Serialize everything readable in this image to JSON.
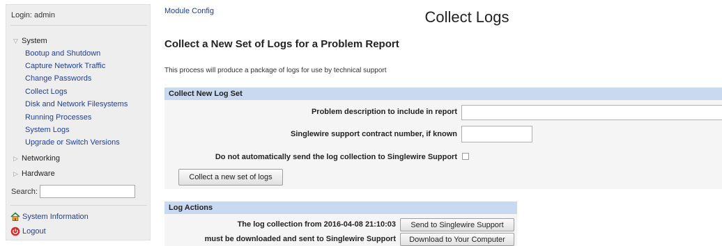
{
  "sidebar": {
    "login": "Login: admin",
    "system": {
      "label": "System",
      "items": [
        "Bootup and Shutdown",
        "Capture Network Traffic",
        "Change Passwords",
        "Collect Logs",
        "Disk and Network Filesystems",
        "Running Processes",
        "System Logs",
        "Upgrade or Switch Versions"
      ]
    },
    "networking": "Networking",
    "hardware": "Hardware",
    "search_label": "Search:",
    "search_value": "",
    "system_information": "System Information",
    "logout": "Logout"
  },
  "main": {
    "module_config": "Module Config",
    "title": "Collect Logs",
    "heading": "Collect a New Set of Logs for a Problem Report",
    "description": "This process will produce a package of logs for use by technical support",
    "collect_section": {
      "header": "Collect New Log Set",
      "problem_label": "Problem description to include in report",
      "problem_value": "",
      "contract_label": "Singlewire support contract number, if known",
      "contract_value": "",
      "nosend_label": "Do not automatically send the log collection to Singlewire Support",
      "nosend_checked": false,
      "collect_button": "Collect a new set of logs"
    },
    "log_actions": {
      "header": "Log Actions",
      "line1": "The log collection from 2016-04-08 21:10:03",
      "line2": "must be downloaded and sent to Singlewire Support",
      "send_button": "Send to Singlewire Support",
      "download_button": "Download to Your Computer"
    }
  },
  "colors": {
    "link": "#1f3e9e",
    "section_header_bg": "#c9d9f0",
    "sidebar_bg": "#eeeeee"
  }
}
